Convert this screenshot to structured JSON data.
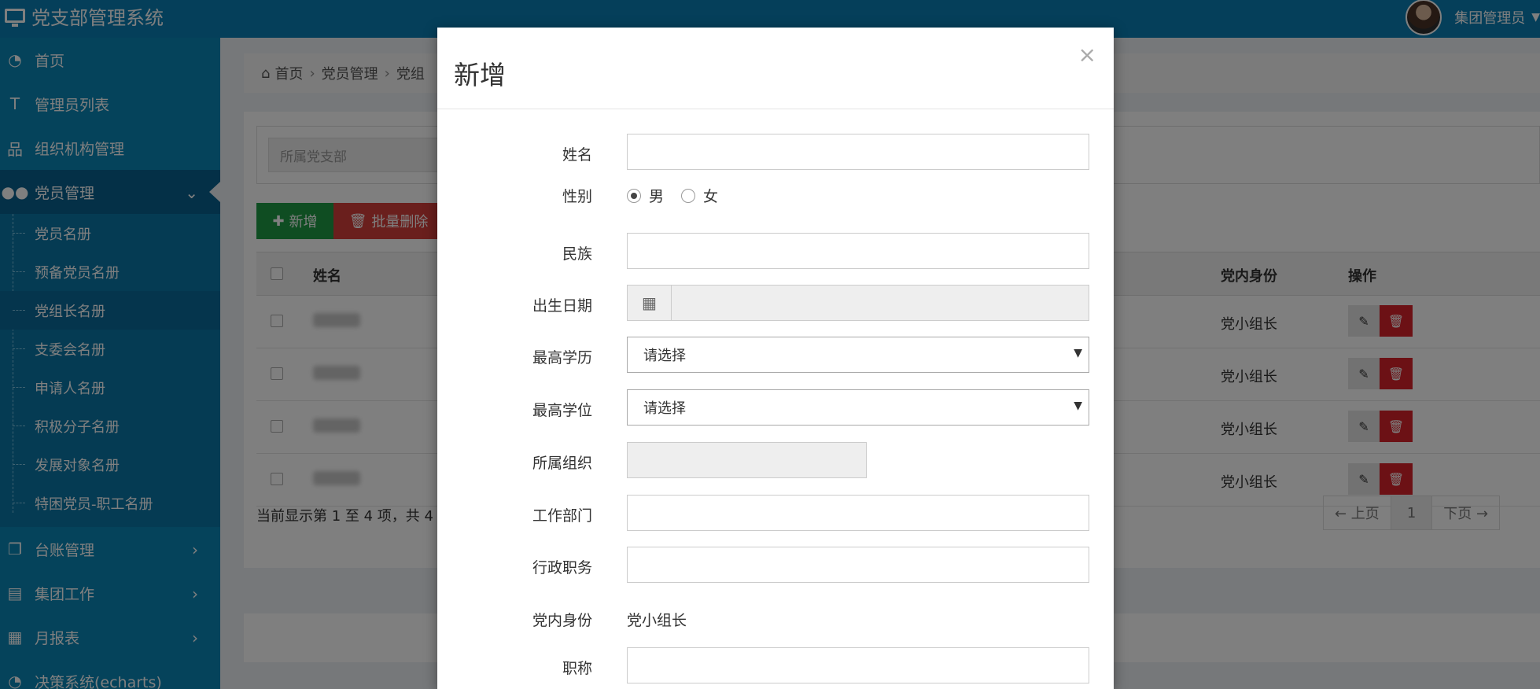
{
  "app": {
    "title": "党支部管理系统",
    "user_name": "集团管理员"
  },
  "sidebar": {
    "items": [
      {
        "label": "首页",
        "icon": "dashboard-icon"
      },
      {
        "label": "管理员列表",
        "icon": "text-icon"
      },
      {
        "label": "组织机构管理",
        "icon": "sitemap-icon"
      },
      {
        "label": "党员管理",
        "icon": "users-icon"
      }
    ],
    "subitems": [
      "党员名册",
      "预备党员名册",
      "党组长名册",
      "支委会名册",
      "申请人名册",
      "积极分子名册",
      "发展对象名册",
      "特困党员-职工名册"
    ],
    "items_after": [
      {
        "label": "台账管理",
        "icon": "copy-icon"
      },
      {
        "label": "集团工作",
        "icon": "file-icon"
      },
      {
        "label": "月报表",
        "icon": "calendar-icon"
      },
      {
        "label": "决策系统(echarts)",
        "icon": "dashboard-icon"
      }
    ]
  },
  "breadcrumb": {
    "home": "首页",
    "level1": "党员管理",
    "level2": "党组"
  },
  "filter": {
    "placeholder": "所属党支部"
  },
  "toolbar": {
    "add_label": "新增",
    "batch_delete_label": "批量删除"
  },
  "table": {
    "headers": {
      "name": "姓名",
      "role": "党内身份",
      "ops": "操作"
    },
    "rows": [
      {
        "role": "党小组长"
      },
      {
        "role": "党小组长"
      },
      {
        "role": "党小组长"
      },
      {
        "role": "党小组长"
      }
    ]
  },
  "pagination": {
    "info": "当前显示第 1 至 4 项，共 4",
    "prev": "← 上页",
    "page": "1",
    "next": "下页 →"
  },
  "modal": {
    "title": "新增",
    "close": "×",
    "fields": {
      "name": "姓名",
      "gender": "性别",
      "gender_male": "男",
      "gender_female": "女",
      "ethnicity": "民族",
      "birthdate": "出生日期",
      "education": "最高学历",
      "education_value": "请选择",
      "degree": "最高学位",
      "degree_value": "请选择",
      "org": "所属组织",
      "department": "工作部门",
      "position": "行政职务",
      "party_role": "党内身份",
      "party_role_value": "党小组长",
      "title": "职称"
    }
  },
  "colors": {
    "header": "#0a7fb5",
    "sidebar": "#0b86b6",
    "add": "#1e9a44",
    "delete": "#d43f3a"
  }
}
